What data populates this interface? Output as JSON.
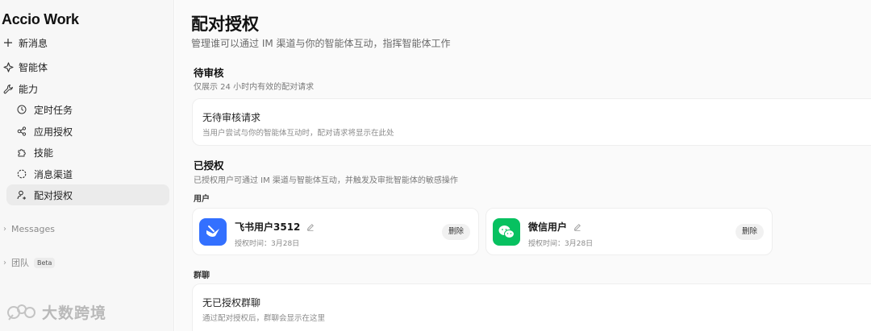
{
  "sidebar": {
    "brand": "Accio Work",
    "items": [
      {
        "label": "新消息"
      },
      {
        "label": "智能体"
      },
      {
        "label": "能力"
      },
      {
        "label": "定时任务"
      },
      {
        "label": "应用授权"
      },
      {
        "label": "技能"
      },
      {
        "label": "消息渠道"
      },
      {
        "label": "配对授权"
      }
    ],
    "messages_label": "Messages",
    "team_label": "团队",
    "beta_badge": "Beta",
    "watermark": "大数跨境"
  },
  "main": {
    "title": "配对授权",
    "subtitle": "管理谁可以通过 IM 渠道与你的智能体互动，指挥智能体工作",
    "pending": {
      "title": "待审核",
      "desc": "仅展示 24 小时内有效的配对请求",
      "empty_title": "无待审核请求",
      "empty_desc": "当用户尝试与你的智能体互动时，配对请求将显示在此处"
    },
    "authorized": {
      "title": "已授权",
      "desc": "已授权用户可通过 IM 渠道与智能体互动，并触发及审批智能体的敏感操作",
      "users_label": "用户",
      "users": [
        {
          "name": "飞书用户3512",
          "time": "授权时间：3月28日",
          "delete": "删除"
        },
        {
          "name": "微信用户",
          "time": "授权时间：3月28日",
          "delete": "删除"
        }
      ],
      "groups_label": "群聊",
      "groups_empty_title": "无已授权群聊",
      "groups_empty_desc": "通过配对授权后，群聊会显示在这里"
    }
  },
  "colors": {
    "feishu": "#3370ff",
    "wechat": "#07c160",
    "active_bg": "#ebebeb"
  }
}
